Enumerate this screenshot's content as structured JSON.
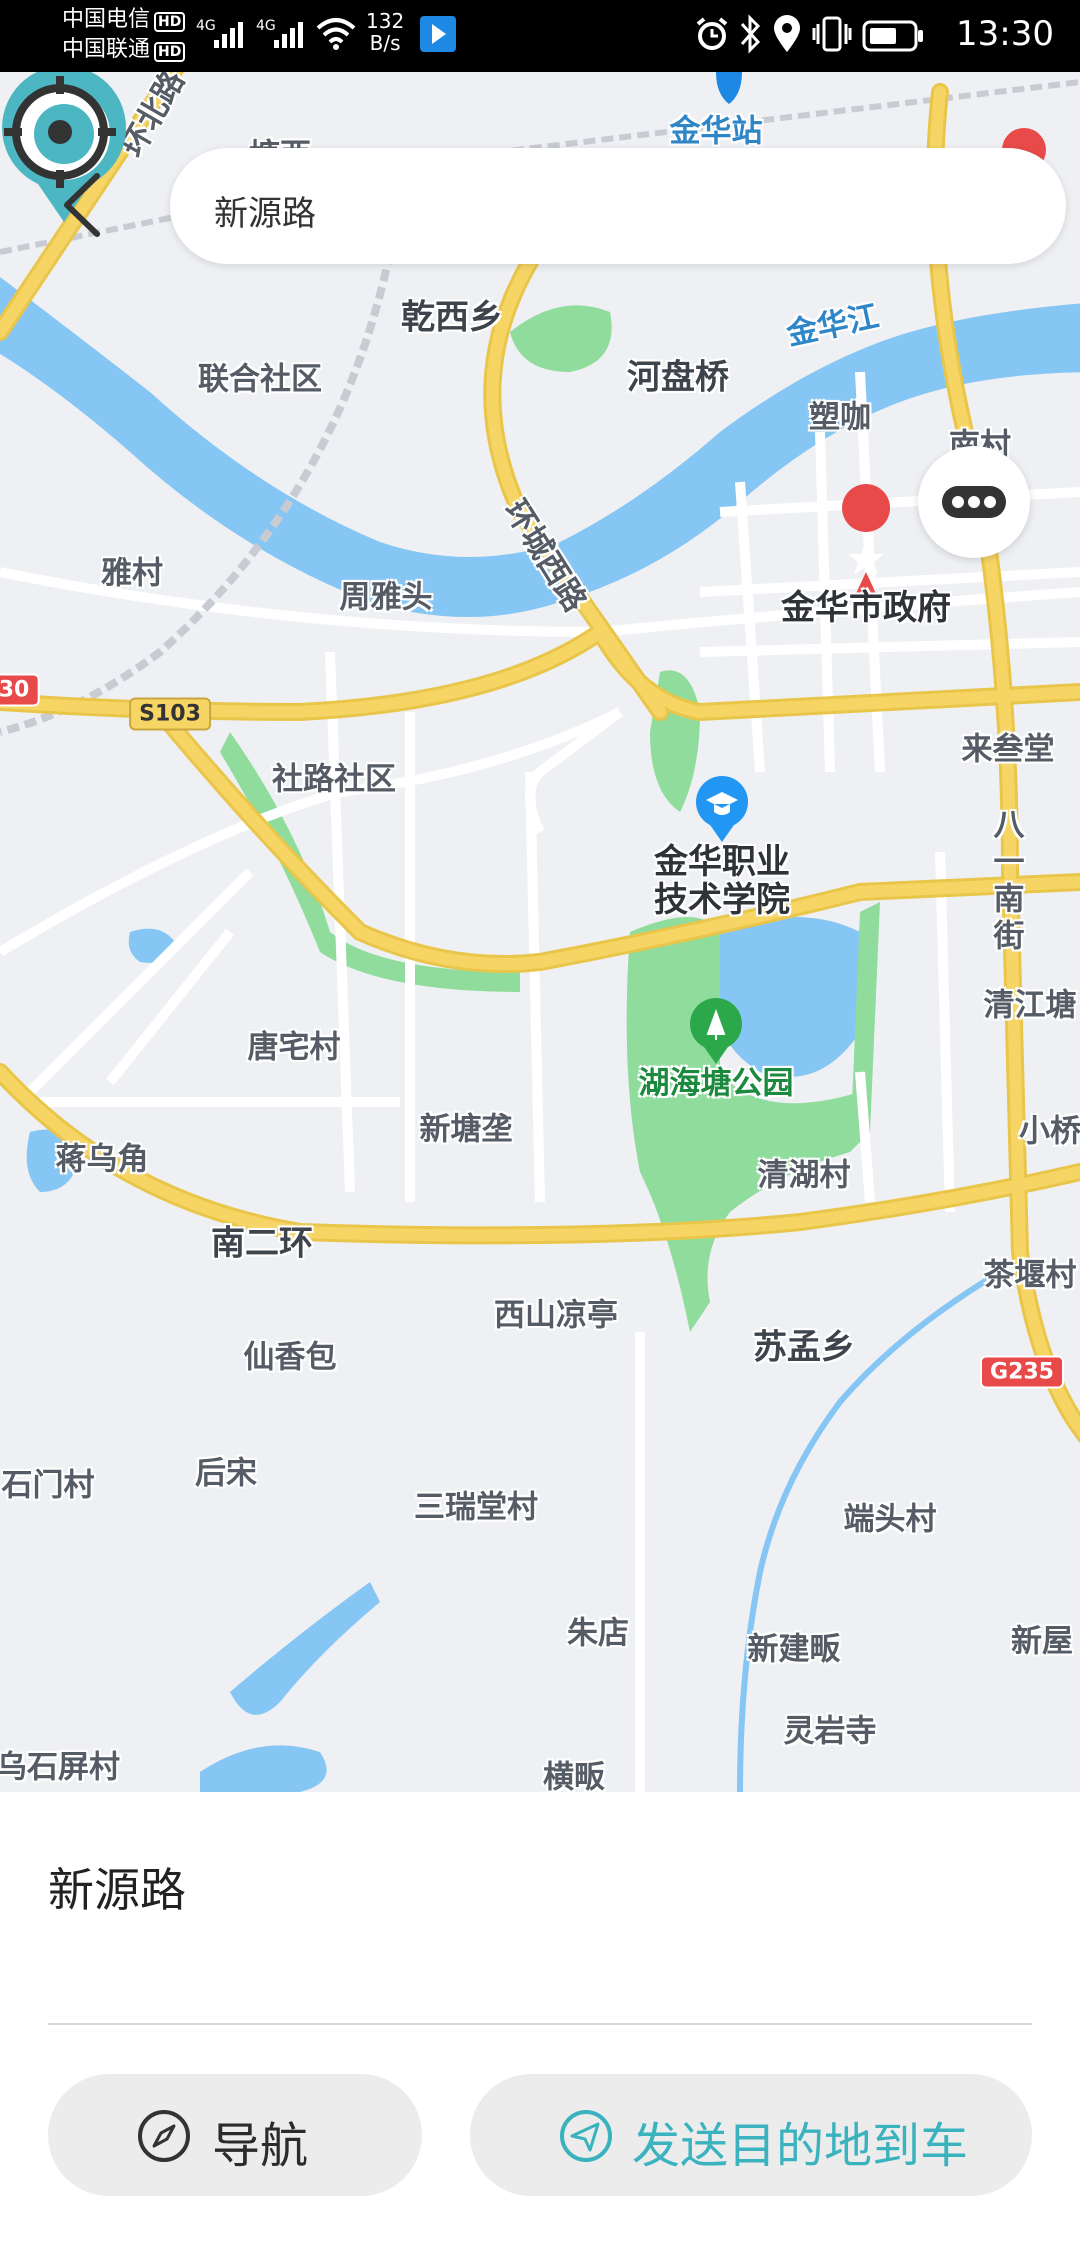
{
  "status_bar": {
    "carrier1": "中国电信",
    "carrier2": "中国联通",
    "hd": "HD",
    "net_type": "4G",
    "speed_value": "132",
    "speed_unit": "B/s",
    "time": "13:30"
  },
  "search": {
    "value": "新源路"
  },
  "map": {
    "labels": [
      "金华站",
      "乾西乡",
      "联合社区",
      "河盘桥",
      "金华江",
      "塑咖",
      "雅村",
      "周雅头",
      "环城西路",
      "金华市政府",
      "社路社区",
      "来叁堂",
      "八一南街",
      "金华职业",
      "技术学院",
      "唐宅村",
      "湖海塘公园",
      "清江塘",
      "蒋乌角",
      "新塘垄",
      "小桥",
      "清湖村",
      "南二环",
      "茶堰村",
      "西山凉亭",
      "仙香包",
      "苏孟乡",
      "石门村",
      "后宋",
      "三瑞堂村",
      "端头村",
      "朱店",
      "新建畈",
      "新屋",
      "灵岩寺",
      "乌石屏村",
      "横畈",
      "塘西",
      "南村",
      "环北路"
    ],
    "shields": [
      "S103",
      "G235",
      "30"
    ],
    "colors": {
      "water": "#86c6f4",
      "park": "#8fdc9d",
      "road_major": "#f6d565",
      "road_minor": "#ffffff",
      "land": "#eef0f3",
      "pin": "#4db6c3"
    }
  },
  "panel": {
    "destination": "新源路",
    "nav_label": "导航",
    "send_label": "发送目的地到车"
  }
}
